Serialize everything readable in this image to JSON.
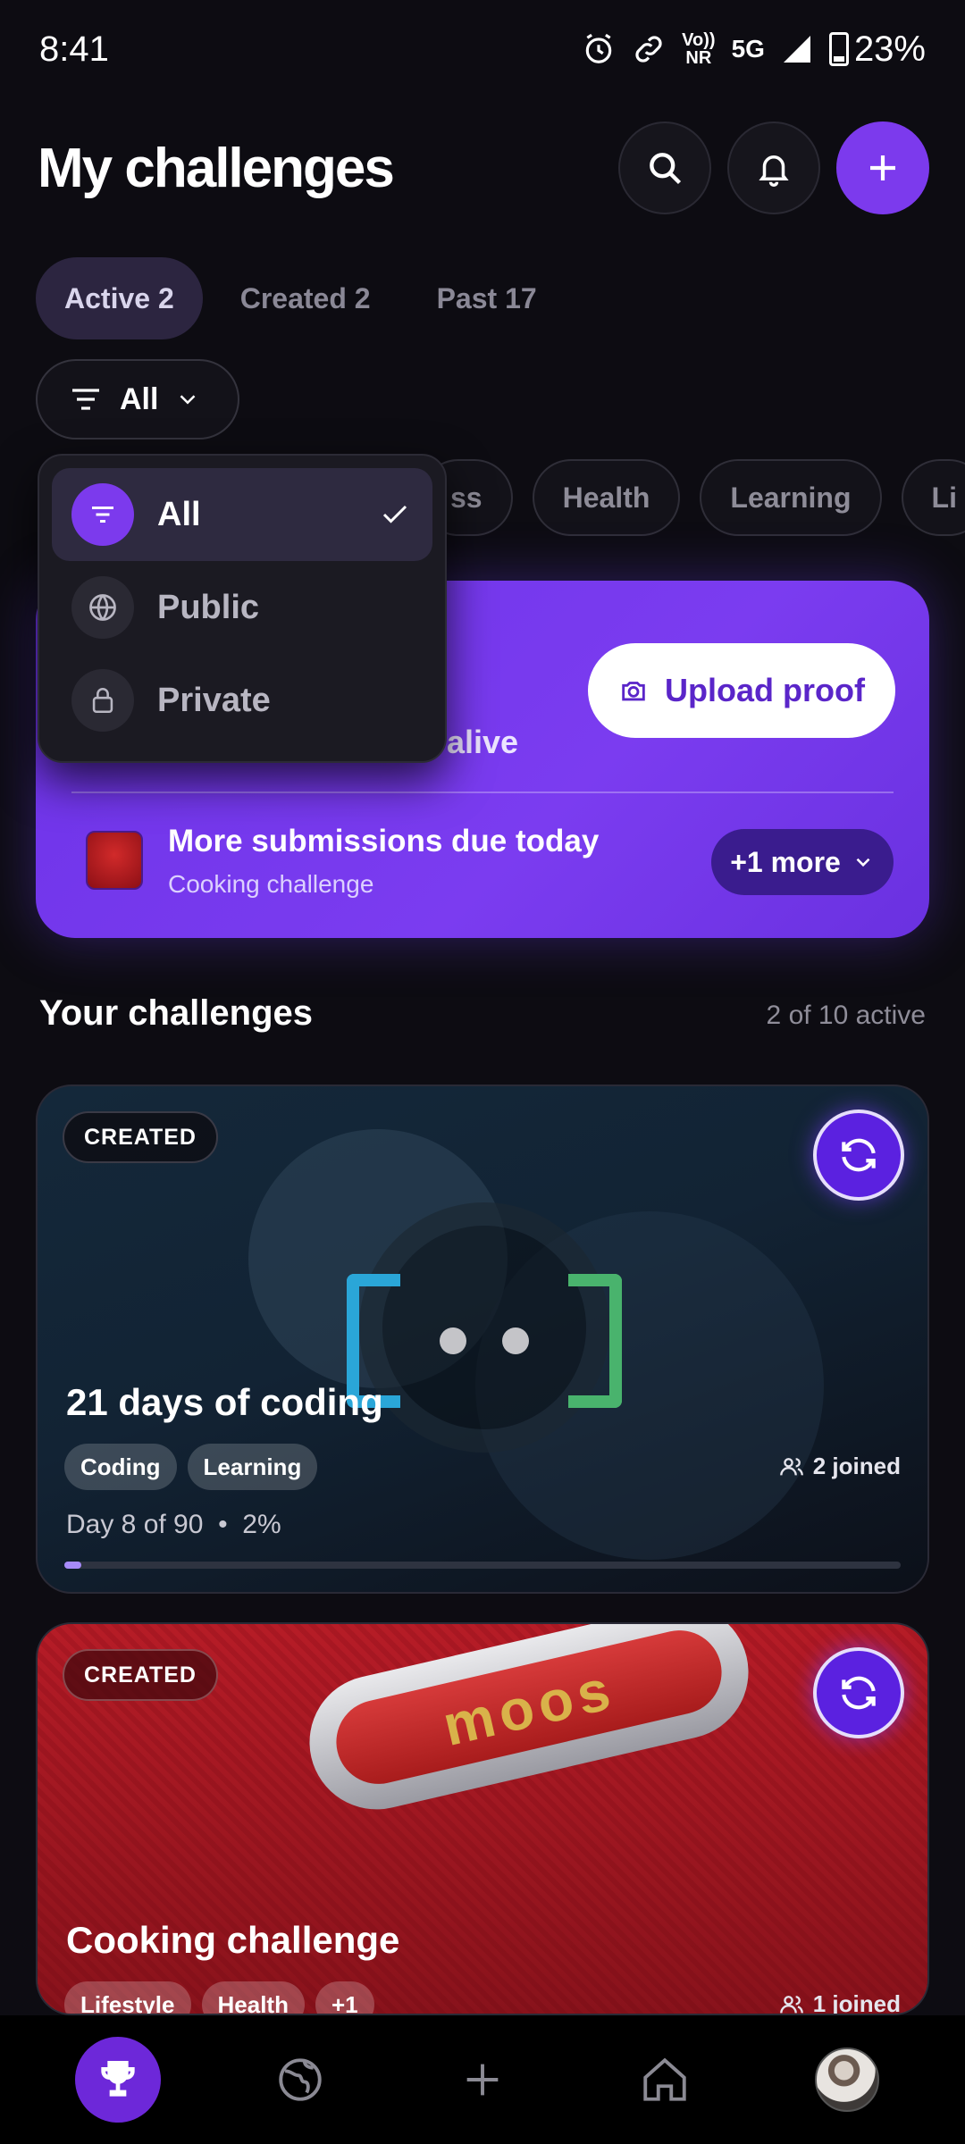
{
  "status_bar": {
    "time": "8:41",
    "network_top": "Vo))",
    "network_bottom": "NR",
    "signal_type": "5G",
    "battery": "23%"
  },
  "header": {
    "title": "My challenges"
  },
  "tabs": [
    {
      "label": "Active 2",
      "active": true
    },
    {
      "label": "Created 2",
      "active": false
    },
    {
      "label": "Past 17",
      "active": false
    }
  ],
  "filter": {
    "label": "All"
  },
  "dropdown": {
    "options": [
      {
        "label": "All",
        "icon": "filter-icon",
        "selected": true
      },
      {
        "label": "Public",
        "icon": "globe-icon",
        "selected": false
      },
      {
        "label": "Private",
        "icon": "lock-icon",
        "selected": false
      }
    ]
  },
  "category_chips": [
    "ss",
    "Health",
    "Learning",
    "Li"
  ],
  "banner": {
    "partial_text": "alive",
    "upload_label": "Upload proof",
    "due_title": "More submissions due today",
    "due_subtitle": "Cooking challenge",
    "more_label": "+1 more"
  },
  "section": {
    "title": "Your challenges",
    "count": "2 of 10 active"
  },
  "cards": [
    {
      "badge": "CREATED",
      "title": "21 days of coding",
      "tags": [
        "Coding",
        "Learning"
      ],
      "joined": "2 joined",
      "progress_text": "Day 8 of 90",
      "progress_percent_label": "2%",
      "progress": 0.02
    },
    {
      "badge": "CREATED",
      "title": "Cooking challenge",
      "tags": [
        "Lifestyle",
        "Health",
        "+1"
      ],
      "joined": "1 joined",
      "image_text": "moos"
    }
  ],
  "colors": {
    "accent": "#7c3aed",
    "background": "#0d0c12",
    "banner": "#6d33e8"
  },
  "bottom_nav": [
    "trophy-icon",
    "globe-icon",
    "plus-icon",
    "home-icon",
    "avatar"
  ]
}
